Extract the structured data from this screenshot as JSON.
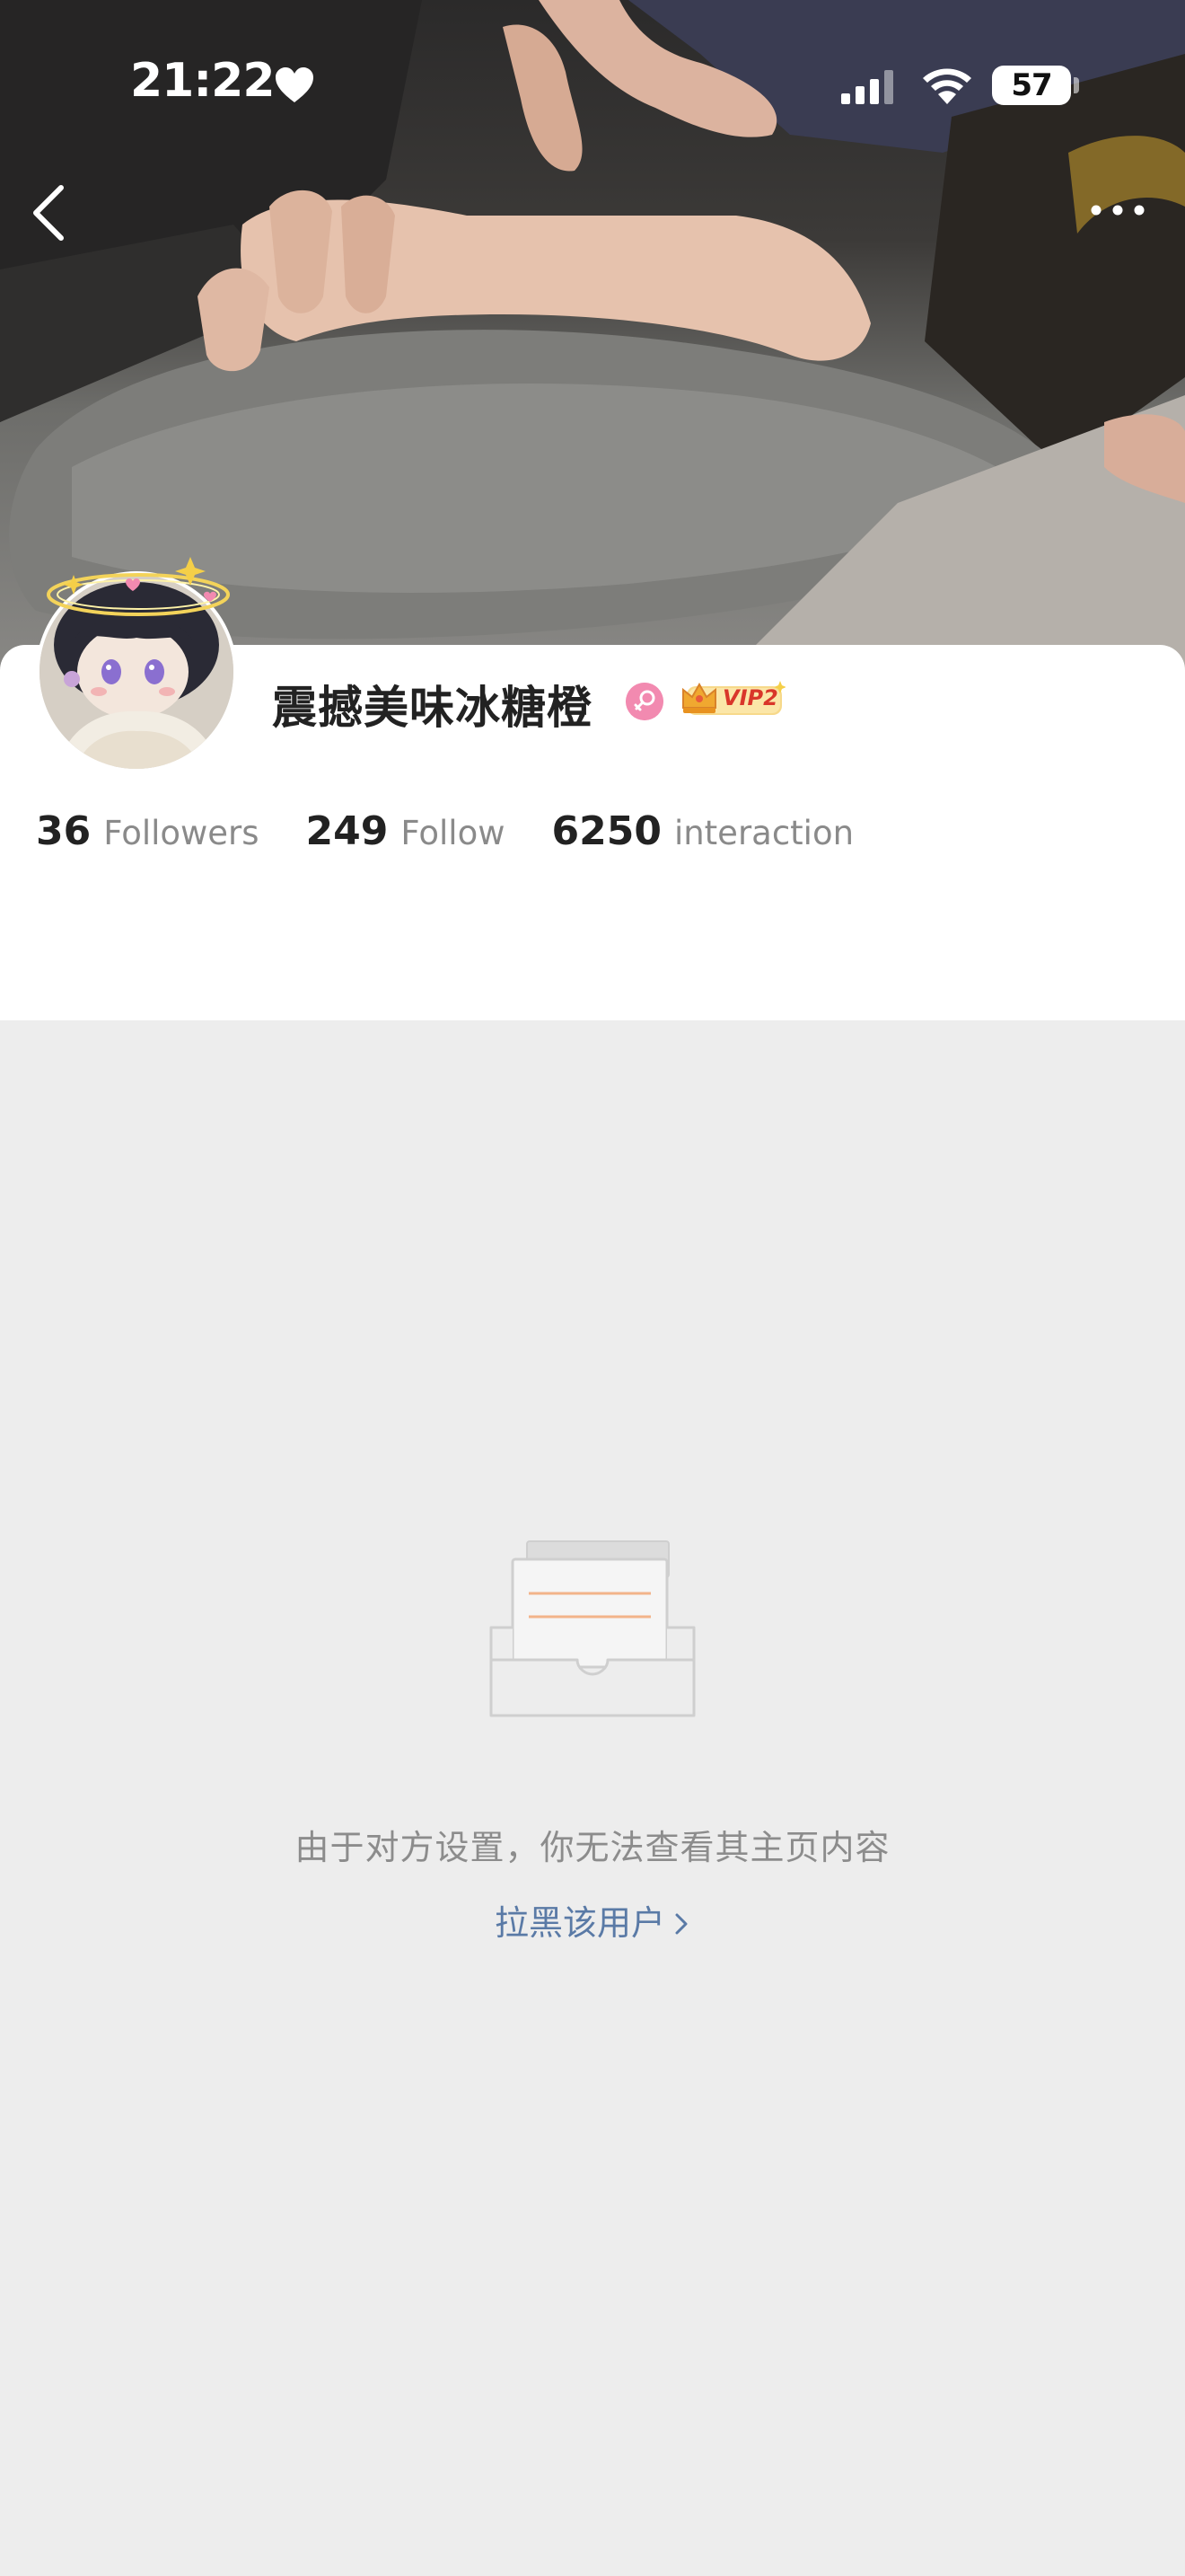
{
  "status_bar": {
    "time": "21:22",
    "battery_level": "57",
    "icons": [
      "heart-icon",
      "cellular-signal-icon",
      "wifi-icon",
      "battery-icon"
    ]
  },
  "nav": {
    "back_icon": "chevron-left-icon",
    "more_icon": "more-dots-icon"
  },
  "profile": {
    "username": "震撼美味冰糖橙",
    "gender_icon": "female-icon",
    "vip_label": "VIP2",
    "stats": [
      {
        "value": "36",
        "label": "Followers"
      },
      {
        "value": "249",
        "label": "Follow"
      },
      {
        "value": "6250",
        "label": "interaction"
      }
    ]
  },
  "empty_state": {
    "icon": "empty-inbox-icon",
    "message": "由于对方设置，你无法查看其主页内容",
    "block_link": "拉黑该用户"
  },
  "colors": {
    "page_background": "#ededed",
    "card_background": "#ffffff",
    "link": "#5a7aa6",
    "muted_text": "#8c8c8c",
    "gender_badge": "#f28ab0",
    "vip_gold": "#f0a830"
  }
}
